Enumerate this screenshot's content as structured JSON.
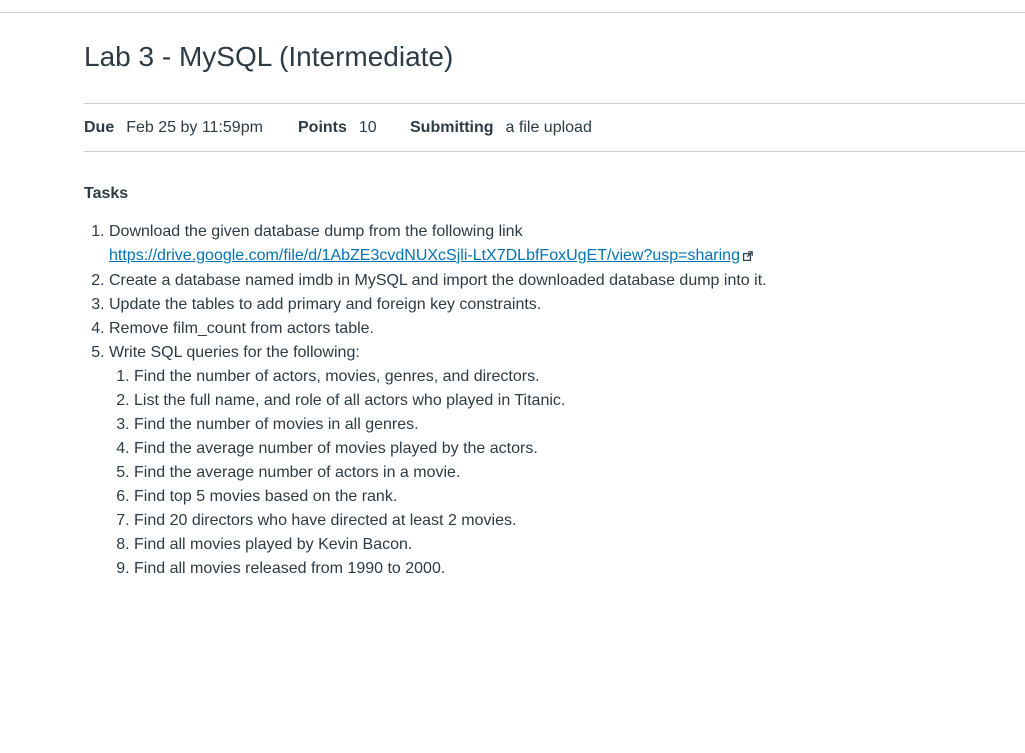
{
  "assignment": {
    "title": "Lab 3 - MySQL (Intermediate)"
  },
  "details": {
    "due_label": "Due",
    "due_value": "Feb 25 by 11:59pm",
    "points_label": "Points",
    "points_value": "10",
    "submitting_label": "Submitting",
    "submitting_value": "a file upload"
  },
  "content": {
    "heading": "Tasks",
    "tasks": [
      "Download the given database dump from the following link",
      "Create a database named imdb in MySQL and import the downloaded database dump into it.",
      "Update the tables to add primary and foreign key constraints.",
      "Remove film_count from actors table.",
      "Write SQL queries for the following:"
    ],
    "link": "https://drive.google.com/file/d/1AbZE3cvdNUXcSjli-LtX7DLbfFoxUgET/view?usp=sharing",
    "link_icon": "external-link-icon",
    "queries": [
      "Find the number of actors, movies, genres, and directors.",
      "List the full name, and role of all actors who played in Titanic.",
      "Find the number of movies in all genres.",
      "Find the average number of movies played by the actors.",
      "Find the average number of actors in a movie.",
      "Find top 5 movies based on the rank.",
      "Find 20 directors who have directed at least 2 movies.",
      "Find all movies played by Kevin Bacon.",
      "Find all movies released from 1990 to 2000."
    ]
  },
  "colors": {
    "text": "#2d3b45",
    "link": "#0374b5",
    "rule": "#c7cdd1"
  }
}
